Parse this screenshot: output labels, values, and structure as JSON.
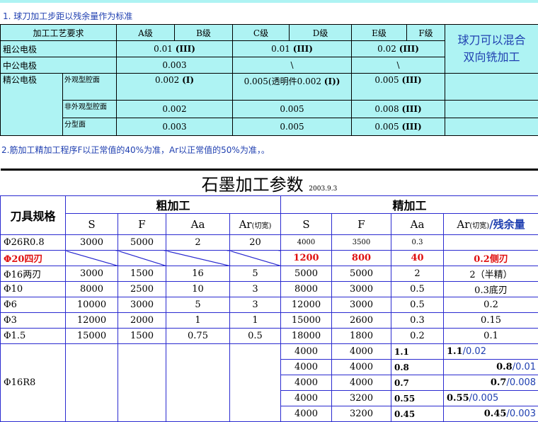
{
  "note1": "1. 球刀加工步距以残余量作为标准",
  "note2": "2.筋加工精加工程序F以正常值的40%为准，Ar以正常值的50%为准，。",
  "t1": {
    "header": {
      "process": "加工工艺要求",
      "a": "A级",
      "b": "B级",
      "c": "C级",
      "d": "D级",
      "e": "E级",
      "f": "F级"
    },
    "rough": {
      "label": "粗公电极",
      "ab": "0.01",
      "ab_grade": "(III)",
      "cd": "0.01",
      "cd_grade": "(III)",
      "ef": "0.02",
      "ef_grade": "(III)"
    },
    "mid": {
      "label": "中公电极",
      "ab": "0.003",
      "cd": "\\",
      "ef": "\\"
    },
    "fine": {
      "label": "精公电极",
      "sub1": "外观型腔面",
      "sub1_ab": "0.002",
      "sub1_ab_grade": "(I)",
      "sub1_cd": "0.005(透明件0.002",
      "sub1_cd_grade": "(I))",
      "sub1_ef": "0.005",
      "sub1_ef_grade": "(III)",
      "sub2": "非外观型腔面",
      "sub2_ab": "0.002",
      "sub2_cd": "0.005",
      "sub2_ef": "0.008",
      "sub2_ef_grade": "(III)",
      "sub3": "分型面",
      "sub3_ab": "0.003",
      "sub3_cd": "0.005",
      "sub3_ef": "0.005",
      "sub3_ef_grade": "(III)"
    },
    "side_note_1": "球刀可以混合",
    "side_note_2": "双向铣加工"
  },
  "t2": {
    "title": "石墨加工参数",
    "date": "2003.9.3",
    "spec": "刀具规格",
    "rough": "粗加工",
    "fine": "精加工",
    "cols": {
      "s": "S",
      "f": "F",
      "aa": "Aa",
      "ar": "Ar",
      "ar_note": "(切宽)",
      "residual": "/残余量"
    },
    "rows": [
      {
        "spec": "Φ26R0.8",
        "s": "3000",
        "f": "5000",
        "aa": "2",
        "ar": "20",
        "fs": "4000",
        "ff": "3500",
        "faa": "0.3",
        "far": ""
      },
      {
        "spec": "Φ20四刃",
        "s": "",
        "f": "",
        "aa": "",
        "ar": "",
        "fs": "1200",
        "ff": "800",
        "faa": "40",
        "far": "0.2侧刃"
      },
      {
        "spec": "Φ16两刃",
        "s": "3000",
        "f": "1500",
        "aa": "16",
        "ar": "5",
        "fs": "5000",
        "ff": "5000",
        "faa": "2",
        "far": "2（半精）"
      },
      {
        "spec": "Φ10",
        "s": "8000",
        "f": "2500",
        "aa": "10",
        "ar": "3",
        "fs": "8000",
        "ff": "3000",
        "faa": "0.5",
        "far": "0.3底刃"
      },
      {
        "spec": "Φ6",
        "s": "10000",
        "f": "3000",
        "aa": "5",
        "ar": "3",
        "fs": "12000",
        "ff": "3000",
        "faa": "0.5",
        "far": "0.2"
      },
      {
        "spec": "Φ3",
        "s": "12000",
        "f": "2000",
        "aa": "1",
        "ar": "1",
        "fs": "15000",
        "ff": "2600",
        "faa": "0.3",
        "far": "0.15"
      },
      {
        "spec": "Φ1.5",
        "s": "15000",
        "f": "1500",
        "aa": "0.75",
        "ar": "0.5",
        "fs": "18000",
        "ff": "1800",
        "faa": "0.2",
        "far": "0.1"
      }
    ],
    "r8": {
      "spec": "Φ16R8",
      "rows": [
        {
          "fs": "4000",
          "ff": "4000",
          "faa": "1.1",
          "ar_a": "1.1",
          "ar_b": "0.02"
        },
        {
          "fs": "4000",
          "ff": "4000",
          "faa": "0.8",
          "ar_a": "0.8",
          "ar_b": "0.01"
        },
        {
          "fs": "4000",
          "ff": "4000",
          "faa": "0.7",
          "ar_a": "0.7",
          "ar_b": "0.008"
        },
        {
          "fs": "4000",
          "ff": "3200",
          "faa": "0.55",
          "ar_a": "0.55",
          "ar_b": "0.005"
        },
        {
          "fs": "4000",
          "ff": "3200",
          "faa": "0.45",
          "ar_a": "0.45",
          "ar_b": "0.003"
        }
      ]
    }
  }
}
